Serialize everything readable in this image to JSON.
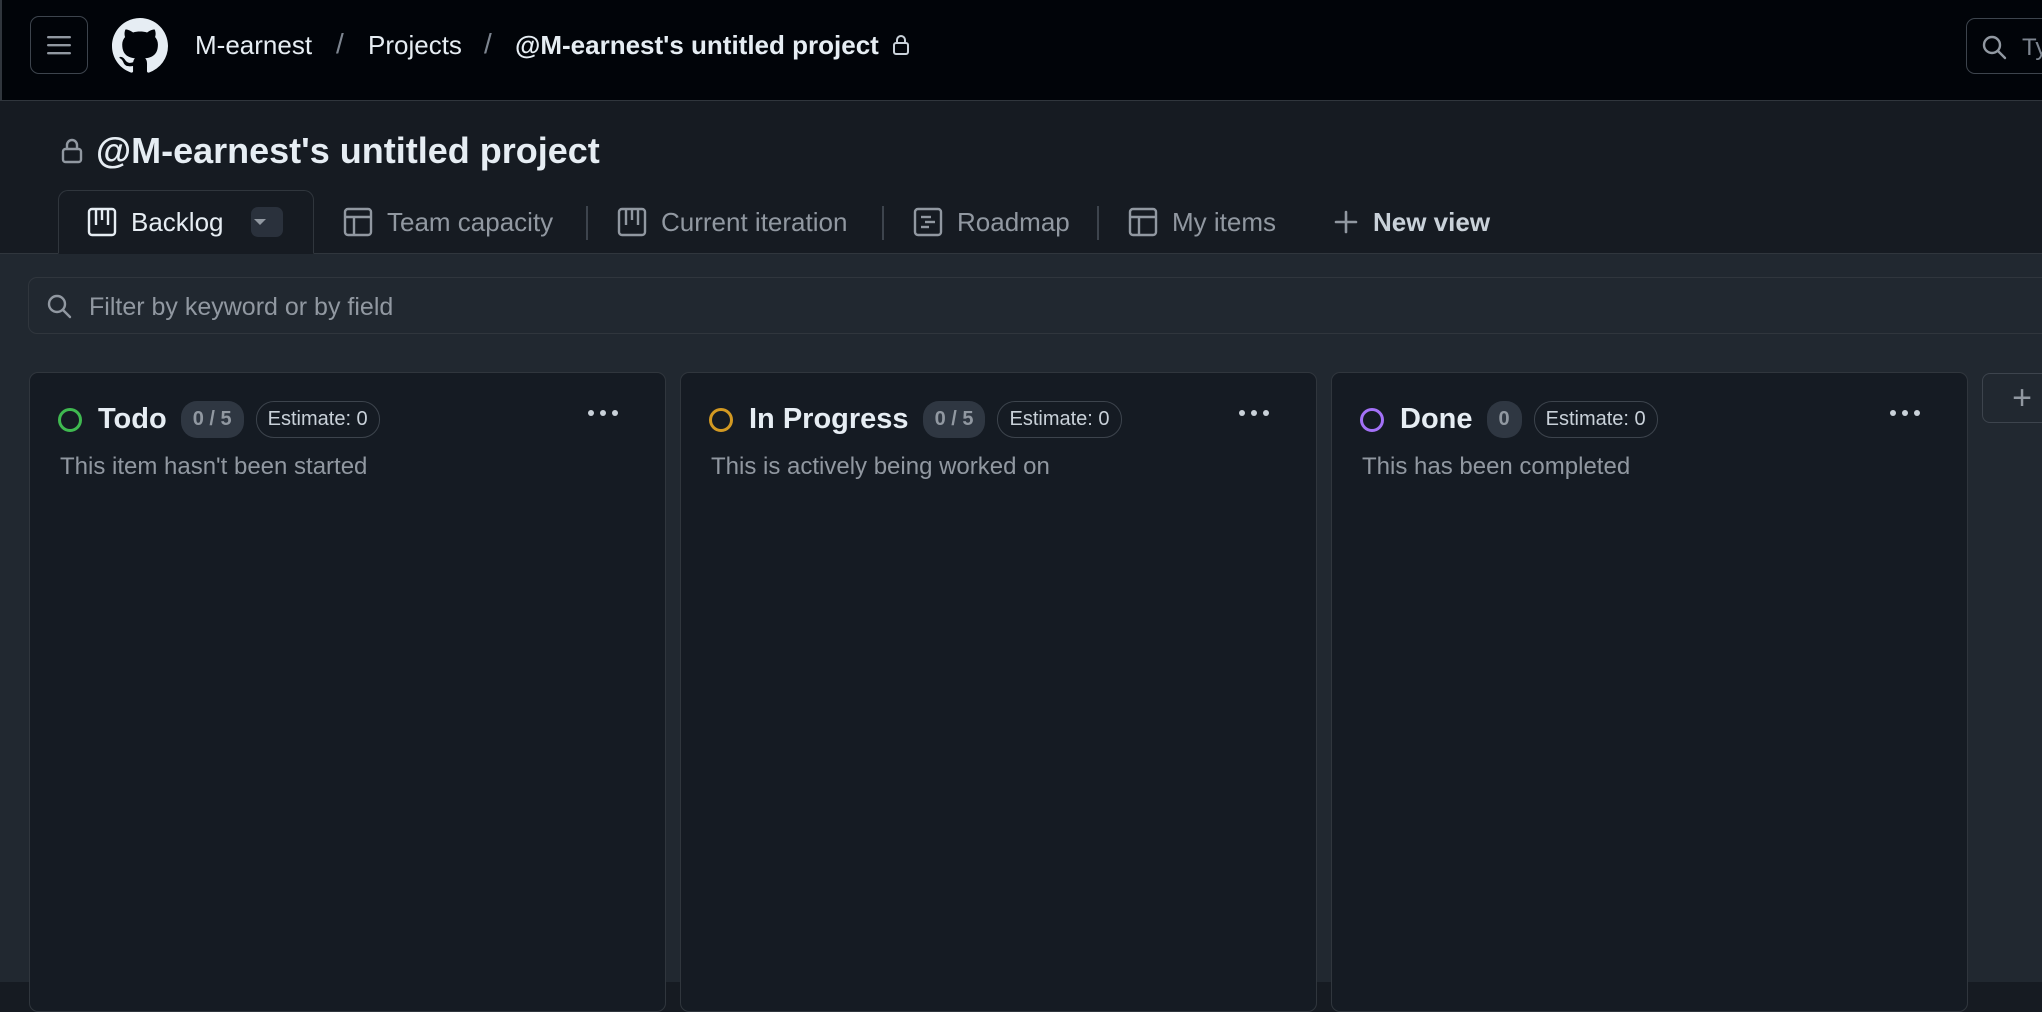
{
  "header": {
    "breadcrumbs": [
      {
        "label": "M-earnest"
      },
      {
        "label": "Projects"
      },
      {
        "label": "@M-earnest's untitled project"
      }
    ],
    "separator": "/",
    "search_placeholder": "Ty"
  },
  "project": {
    "title": "@M-earnest's untitled project"
  },
  "tabs": [
    {
      "label": "Backlog",
      "icon": "board-icon",
      "active": true
    },
    {
      "label": "Team capacity",
      "icon": "table-icon"
    },
    {
      "label": "Current iteration",
      "icon": "board-icon"
    },
    {
      "label": "Roadmap",
      "icon": "roadmap-icon"
    },
    {
      "label": "My items",
      "icon": "table-icon"
    }
  ],
  "new_view_label": "New view",
  "filter": {
    "placeholder": "Filter by keyword or by field"
  },
  "columns": [
    {
      "name": "Todo",
      "count": "0 / 5",
      "estimate": "Estimate: 0",
      "description": "This item hasn't been started",
      "color": "#3fb950"
    },
    {
      "name": "In Progress",
      "count": "0 / 5",
      "estimate": "Estimate: 0",
      "description": "This is actively being worked on",
      "color": "#d29922"
    },
    {
      "name": "Done",
      "count": "0",
      "estimate": "Estimate: 0",
      "description": "This has been completed",
      "color": "#a371f7"
    }
  ],
  "add_column_label": "+"
}
